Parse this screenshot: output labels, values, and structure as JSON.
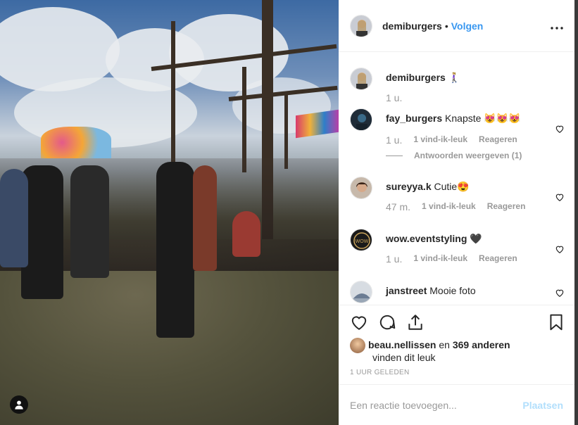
{
  "post": {
    "author": "demiburgers",
    "separator": "•",
    "follow_label": "Volgen",
    "more_label": "•••"
  },
  "caption": {
    "author": "demiburgers",
    "text": "🚶🏼‍♀️",
    "time": "1 u."
  },
  "comments": [
    {
      "author": "fay_burgers",
      "text": "Knapste 😻😻😻",
      "time": "1 u.",
      "likes": "1 vind-ik-leuk",
      "reply": "Reageren",
      "view_replies": "Antwoorden weergeven (1)"
    },
    {
      "author": "sureyya.k",
      "text": "Cutie😍",
      "time": "47 m.",
      "likes": "1 vind-ik-leuk",
      "reply": "Reageren"
    },
    {
      "author": "wow.eventstyling",
      "text": "🖤",
      "time": "1 u.",
      "likes": "1 vind-ik-leuk",
      "reply": "Reageren"
    },
    {
      "author": "janstreet",
      "text": "Mooie foto"
    }
  ],
  "likes": {
    "liker": "beau.nellissen",
    "connector": "en",
    "others": "369 anderen",
    "suffix": "vinden dit leuk"
  },
  "timestamp": "1 UUR GELEDEN",
  "add_comment": {
    "placeholder": "Een reactie toevoegen...",
    "post_label": "Plaatsen"
  },
  "icons": {
    "like": "heart-icon",
    "comment": "comment-icon",
    "share": "share-icon",
    "save": "bookmark-icon",
    "profile": "user-icon"
  },
  "colors": {
    "accent": "#3897f0",
    "post_disabled": "#b2dffc",
    "muted": "#999999",
    "text": "#262626"
  }
}
